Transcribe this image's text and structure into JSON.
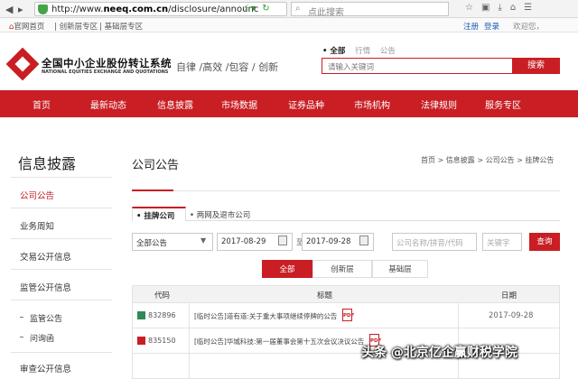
{
  "browser": {
    "url_prefix": "http://www.",
    "url_host": "neeq.com.cn",
    "url_path": "/disclosure/announc",
    "search_placeholder": "点此搜索"
  },
  "bookmarks": {
    "item1": "官网首页",
    "item2": "创新层专区",
    "item3": "基础层专区"
  },
  "account": {
    "register": "注册",
    "login": "登录",
    "welcome": "欢迎您，"
  },
  "header": {
    "logo_cn": "全国中小企业股份转让系统",
    "logo_en": "NATIONAL EQUITIES EXCHANGE AND QUOTATIONS",
    "slogan": "自律 /高效 /包容 / 创新",
    "search_tabs": [
      "• 全部",
      "行情",
      "公告"
    ],
    "search_placeholder": "请输入关键词",
    "search_button": "搜索"
  },
  "mainnav": [
    "首页",
    "最新动态",
    "信息披露",
    "市场数据",
    "证券品种",
    "市场机构",
    "法律规则",
    "服务专区"
  ],
  "sidebar": {
    "title": "信息披露",
    "items": [
      "公司公告",
      "业务周知",
      "交易公开信息",
      "监管公开信息"
    ],
    "subitems": [
      "监管公告",
      "问询函"
    ],
    "last_item": "审查公开信息"
  },
  "content": {
    "title": "公司公告",
    "breadcrumb": "首页 > 信息披露 > 公司公告 > 挂牌公告",
    "tabs": [
      "• 挂牌公司",
      "• 两网及退市公司"
    ]
  },
  "filters": {
    "category": "全部公告",
    "date_from": "2017-08-29",
    "date_sep": "至",
    "date_to": "2017-09-28",
    "company_placeholder": "公司名称/拼音/代码",
    "keyword_placeholder": "关键字",
    "query_button": "查询"
  },
  "levels": [
    "全部",
    "创新层",
    "基础层"
  ],
  "table": {
    "headers": [
      "代码",
      "标题",
      "日期"
    ],
    "rows": [
      {
        "code": "832896",
        "title": "[临时公告]道有道:关于重大事项继续停牌的公告",
        "date": "2017-09-28",
        "icon_color": "#2e8b57"
      },
      {
        "code": "835150",
        "title": "[临时公告]华城科技:第一届董事会第十五次会议决议公告",
        "date": "",
        "icon_color": "#c81e24"
      },
      {
        "code": "",
        "title": "",
        "date": "",
        "icon_color": "#c81e24"
      }
    ]
  },
  "watermark": "头条 @北京亿企赢财税学院"
}
